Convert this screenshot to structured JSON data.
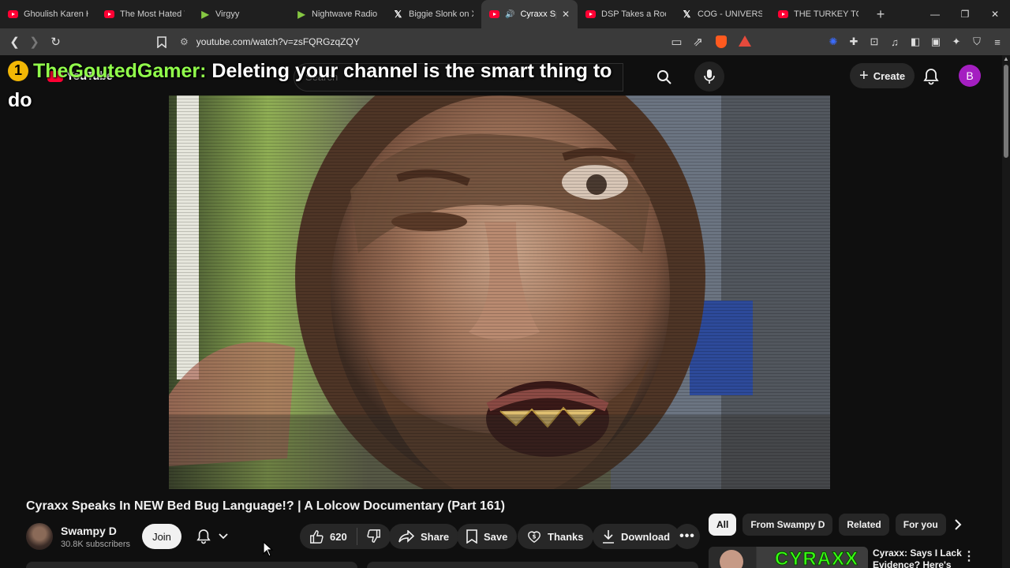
{
  "browser": {
    "tabs": [
      {
        "label": "Ghoulish Karen Ha",
        "icon": "youtube-icon",
        "active": false
      },
      {
        "label": "The Most Hated V",
        "icon": "youtube-icon",
        "active": false
      },
      {
        "label": "Virgyy",
        "icon": "rumble-icon",
        "active": false
      },
      {
        "label": "Nightwave Radio",
        "icon": "rumble-icon",
        "active": false
      },
      {
        "label": "Biggie Slonk on X",
        "icon": "x-icon",
        "active": false
      },
      {
        "label": "Cyraxx Spe",
        "icon": "youtube-icon",
        "active": true
      },
      {
        "label": "DSP Takes a Rock",
        "icon": "youtube-icon",
        "active": false
      },
      {
        "label": "COG - UNIVERSAL",
        "icon": "x-icon",
        "active": false
      },
      {
        "label": "THE TURKEY TOM",
        "icon": "youtube-icon",
        "active": false
      }
    ],
    "new_tab_label": "+",
    "url": "youtube.com/watch?v=zsFQRGzqZQY"
  },
  "youtube": {
    "logo_text": "YouTube",
    "search_placeholder": "Search",
    "create_label": "Create",
    "avatar_letter": "B"
  },
  "overlay": {
    "badge": "1",
    "username": "TheGoutedGamer:",
    "message": " Deleting your channel is the smart thing to do"
  },
  "video": {
    "title": "Cyraxx Speaks In NEW Bed Bug Language!? | A Lolcow Documentary (Part 161)",
    "channel_name": "Swampy D",
    "subscribers": "30.8K subscribers",
    "join_label": "Join",
    "like_count": "620",
    "share_label": "Share",
    "save_label": "Save",
    "thanks_label": "Thanks",
    "download_label": "Download"
  },
  "sidebar": {
    "chips": [
      "All",
      "From Swampy D",
      "Related",
      "For you"
    ],
    "active_chip": "All",
    "recommendation": {
      "thumb_text": "CYRAXX",
      "title": "Cyraxx: Says I Lack Evidence? Here's"
    }
  },
  "colors": {
    "accent": "#ff0033",
    "overlay_username": "#91ff4b",
    "avatar_bg": "#a41fc1"
  }
}
